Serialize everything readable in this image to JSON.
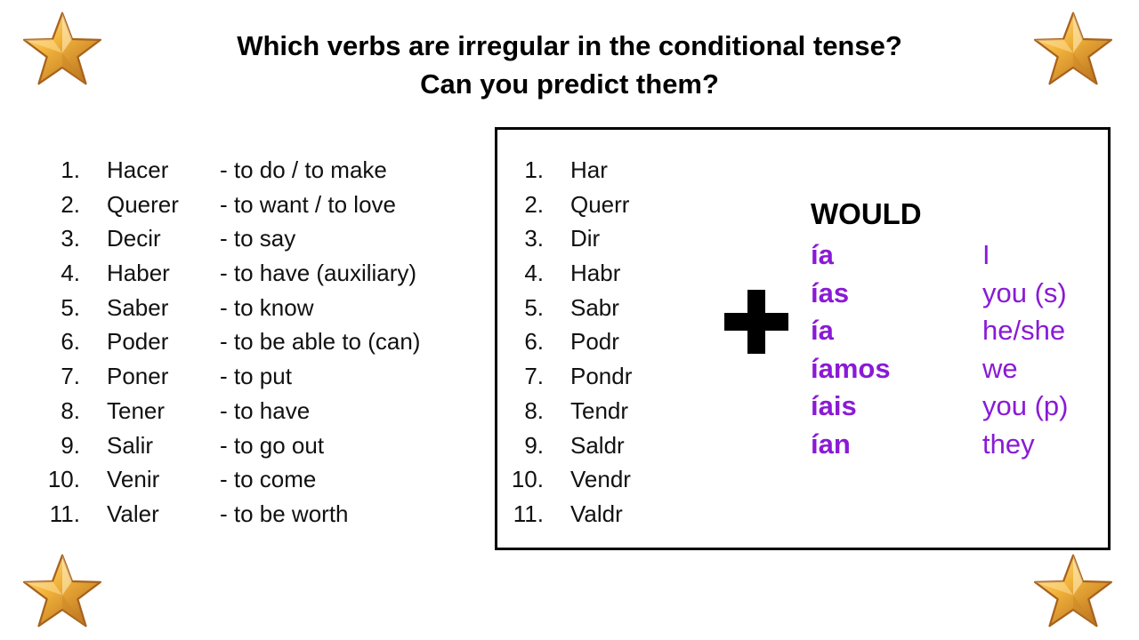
{
  "title": {
    "line1": "Which verbs are irregular in the conditional tense?",
    "line2": "Can you predict them?"
  },
  "decorations": {
    "star_icon": "gold-star",
    "star_color": "#F2B43C"
  },
  "verbs": [
    {
      "num": "1.",
      "verb": "Hacer",
      "meaning": "- to do / to make"
    },
    {
      "num": "2.",
      "verb": "Querer",
      "meaning": "- to want / to love"
    },
    {
      "num": "3.",
      "verb": "Decir",
      "meaning": "- to say"
    },
    {
      "num": "4.",
      "verb": "Haber",
      "meaning": "- to have (auxiliary)"
    },
    {
      "num": "5.",
      "verb": "Saber",
      "meaning": "- to know"
    },
    {
      "num": "6.",
      "verb": "Poder",
      "meaning": "- to be able to (can)"
    },
    {
      "num": "7.",
      "verb": "Poner",
      "meaning": "- to put"
    },
    {
      "num": "8.",
      "verb": "Tener",
      "meaning": "- to have"
    },
    {
      "num": "9.",
      "verb": "Salir",
      "meaning": "- to go out"
    },
    {
      "num": "10.",
      "verb": "Venir",
      "meaning": "- to come"
    },
    {
      "num": "11.",
      "verb": "Valer",
      "meaning": "- to be worth"
    }
  ],
  "stems": [
    {
      "num": "1.",
      "stem": "Har"
    },
    {
      "num": "2.",
      "stem": "Querr"
    },
    {
      "num": "3.",
      "stem": "Dir"
    },
    {
      "num": "4.",
      "stem": "Habr"
    },
    {
      "num": "5.",
      "stem": "Sabr"
    },
    {
      "num": "6.",
      "stem": "Podr"
    },
    {
      "num": "7.",
      "stem": "Pondr"
    },
    {
      "num": "8.",
      "stem": "Tendr"
    },
    {
      "num": "9.",
      "stem": "Saldr"
    },
    {
      "num": "10.",
      "stem": "Vendr"
    },
    {
      "num": "11.",
      "stem": "Valdr"
    }
  ],
  "plus_icon": "plus-sign",
  "would_label": "WOULD",
  "endings_color": "#8A1AD6",
  "endings": [
    {
      "ending": "ía",
      "pronoun": "I"
    },
    {
      "ending": "ías",
      "pronoun": "you (s)"
    },
    {
      "ending": "ía",
      "pronoun": "he/she"
    },
    {
      "ending": "íamos",
      "pronoun": "we"
    },
    {
      "ending": "íais",
      "pronoun": "you (p)"
    },
    {
      "ending": "ían",
      "pronoun": "they"
    }
  ]
}
